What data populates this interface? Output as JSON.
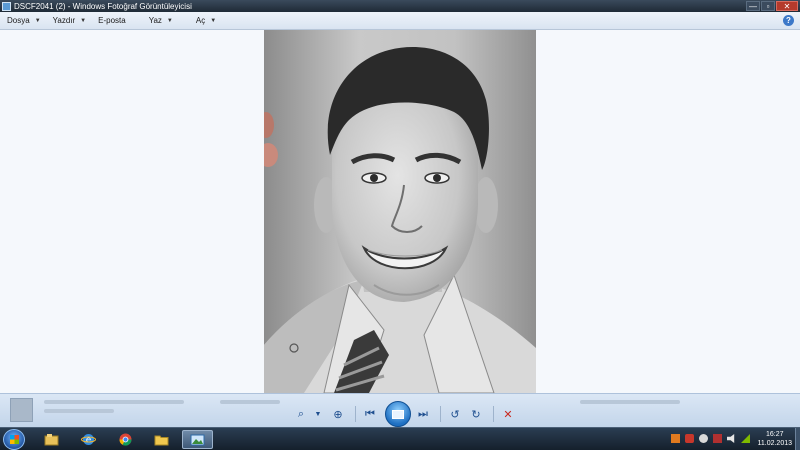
{
  "window": {
    "title": "DSCF2041 (2) - Windows Fotoğraf Görüntüleyicisi",
    "controls": {
      "minimize": "—",
      "maximize": "▫",
      "close": "✕"
    }
  },
  "menu": {
    "items": [
      {
        "label": "Dosya"
      },
      {
        "label": "Yazdır"
      },
      {
        "label": "E-posta"
      },
      {
        "label": "Yaz"
      },
      {
        "label": "Aç"
      }
    ],
    "arrow": "▼",
    "help": "?"
  },
  "photo": {
    "subject": "pencil-portrait"
  },
  "controls": {
    "zoom": "⌕",
    "zoom_arrow": "▼",
    "fit": "⊕",
    "previous": "⏮",
    "next": "⏭",
    "rotate_left": "↺",
    "rotate_right": "↻",
    "delete": "✕"
  },
  "taskbar": {
    "time": "16:27",
    "date": "11.02.2013",
    "pinned": [
      "explorer-library-icon",
      "internet-explorer-icon",
      "chrome-icon",
      "folder-icon",
      "photo-viewer-icon"
    ]
  },
  "colors": {
    "accent": "#1e6fc2",
    "viewer_bg": "#f5f8fc",
    "control_bar": "#c3d5ea",
    "delete_red": "#c9281e"
  }
}
